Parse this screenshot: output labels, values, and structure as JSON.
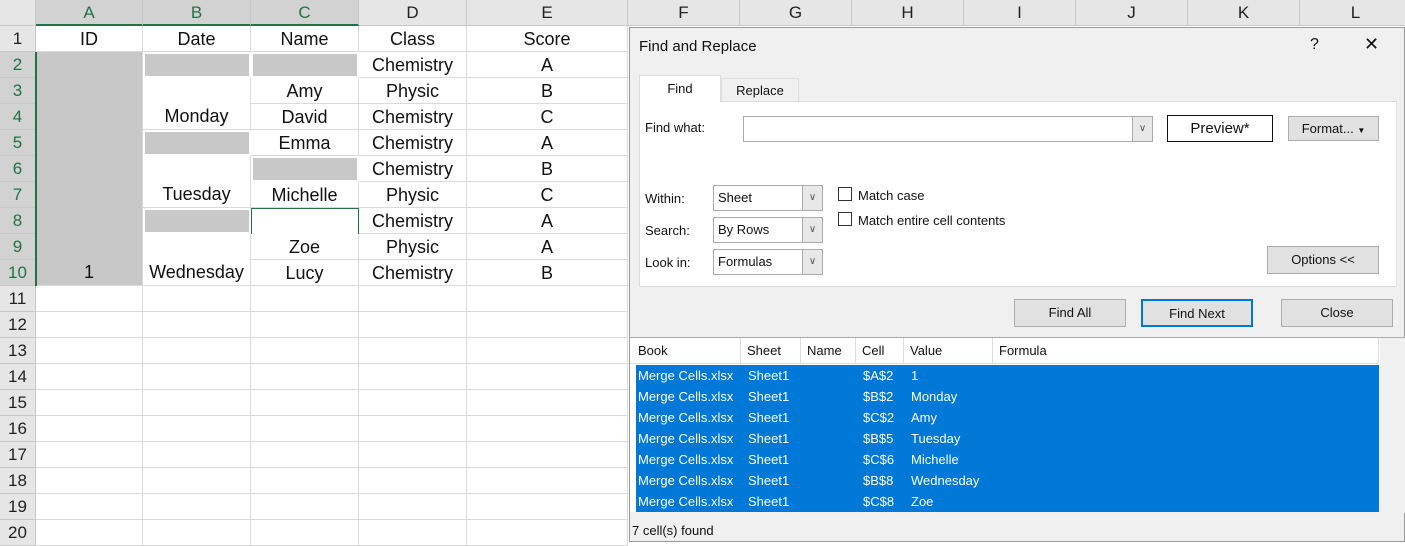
{
  "sheet": {
    "columns": [
      "A",
      "B",
      "C",
      "D",
      "E",
      "F",
      "G",
      "H",
      "I",
      "J",
      "K",
      "L"
    ],
    "rows": [
      "1",
      "2",
      "3",
      "4",
      "5",
      "6",
      "7",
      "8",
      "9",
      "10",
      "11",
      "12",
      "13",
      "14",
      "15",
      "16",
      "17",
      "18",
      "19",
      "20"
    ],
    "header": [
      "ID",
      "Date",
      "Name",
      "Class",
      "Score"
    ],
    "id_value": "1",
    "dates": [
      "Monday",
      "Tuesday",
      "Wednesday"
    ],
    "names": {
      "r3": "Amy",
      "r4": "David",
      "r5": "Emma",
      "r7": "Michelle",
      "r9": "Zoe",
      "r10": "Lucy"
    },
    "classes": [
      "Chemistry",
      "Physic",
      "Chemistry",
      "Chemistry",
      "Chemistry",
      "Physic",
      "Chemistry",
      "Physic",
      "Chemistry"
    ],
    "scores": [
      "A",
      "B",
      "C",
      "A",
      "B",
      "C",
      "A",
      "A",
      "B"
    ]
  },
  "dialog": {
    "title": "Find and Replace",
    "help": "?",
    "close_glyph": "✕",
    "tabs": [
      "Find",
      "Replace"
    ],
    "find_what_label": "Find what:",
    "find_what_value": "",
    "preview": "Preview*",
    "format": "Format...",
    "within_label": "Within:",
    "within_value": "Sheet",
    "search_label": "Search:",
    "search_value": "By Rows",
    "lookin_label": "Look in:",
    "lookin_value": "Formulas",
    "match_case": "Match case",
    "match_entire": "Match entire cell contents",
    "options": "Options <<",
    "find_all": "Find All",
    "find_next": "Find Next",
    "close": "Close",
    "results_headers": [
      "Book",
      "Sheet",
      "Name",
      "Cell",
      "Value",
      "Formula"
    ],
    "results": [
      {
        "book": "Merge Cells.xlsx",
        "sheet": "Sheet1",
        "name": "",
        "cell": "$A$2",
        "value": "1",
        "formula": ""
      },
      {
        "book": "Merge Cells.xlsx",
        "sheet": "Sheet1",
        "name": "",
        "cell": "$B$2",
        "value": "Monday",
        "formula": ""
      },
      {
        "book": "Merge Cells.xlsx",
        "sheet": "Sheet1",
        "name": "",
        "cell": "$C$2",
        "value": "Amy",
        "formula": ""
      },
      {
        "book": "Merge Cells.xlsx",
        "sheet": "Sheet1",
        "name": "",
        "cell": "$B$5",
        "value": "Tuesday",
        "formula": ""
      },
      {
        "book": "Merge Cells.xlsx",
        "sheet": "Sheet1",
        "name": "",
        "cell": "$C$6",
        "value": "Michelle",
        "formula": ""
      },
      {
        "book": "Merge Cells.xlsx",
        "sheet": "Sheet1",
        "name": "",
        "cell": "$B$8",
        "value": "Wednesday",
        "formula": ""
      },
      {
        "book": "Merge Cells.xlsx",
        "sheet": "Sheet1",
        "name": "",
        "cell": "$C$8",
        "value": "Zoe",
        "formula": ""
      }
    ],
    "status": "7 cell(s) found",
    "accent": "#0078d7"
  }
}
